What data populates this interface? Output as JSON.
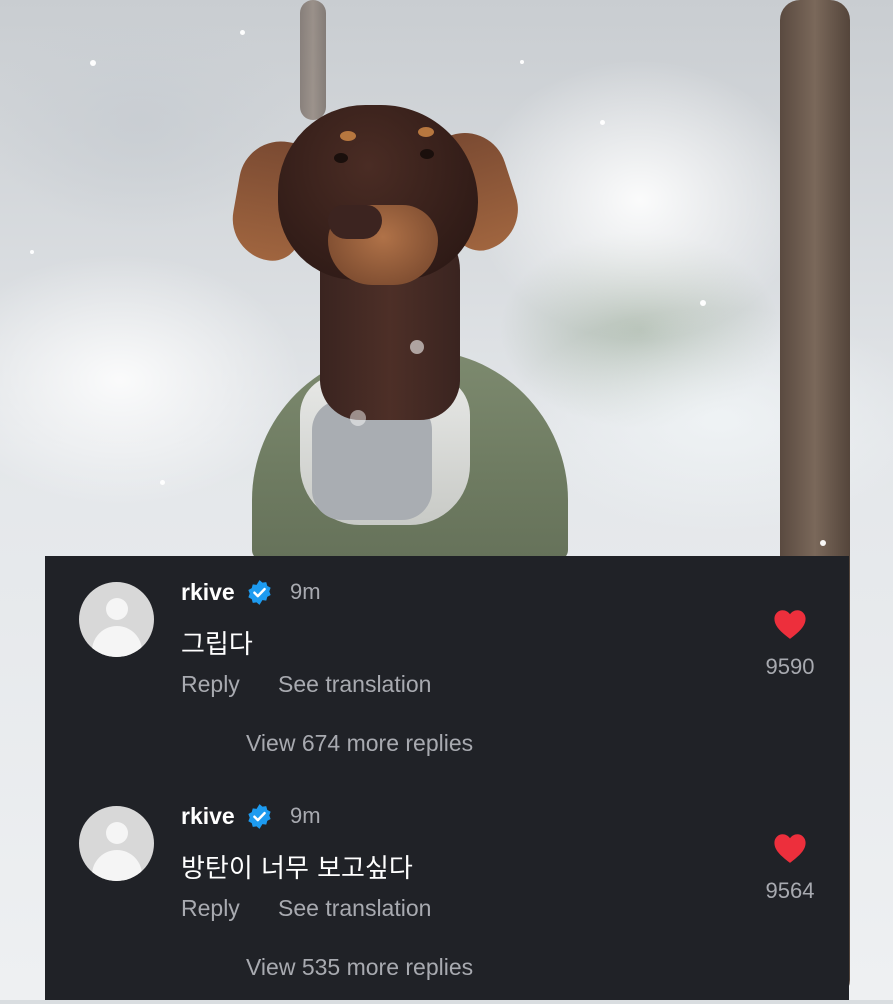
{
  "colors": {
    "panel_bg": "#202227",
    "text_primary": "#ffffff",
    "text_secondary": "#a8aab0",
    "verified": "#1d9bf0",
    "heart": "#ed2f3c",
    "avatar_bg": "#d8d8d8"
  },
  "photo": {
    "icon": "doberman-in-snow-photo"
  },
  "comments": [
    {
      "username": "rkive",
      "verified_icon": "verified-badge-icon",
      "time": "9m",
      "text": "그립다",
      "reply_label": "Reply",
      "translate_label": "See translation",
      "more_replies": "View 674 more replies",
      "likes": "9590",
      "like_icon": "heart-icon"
    },
    {
      "username": "rkive",
      "verified_icon": "verified-badge-icon",
      "time": "9m",
      "text": "방탄이 너무 보고싶다",
      "reply_label": "Reply",
      "translate_label": "See translation",
      "more_replies": "View 535 more replies",
      "likes": "9564",
      "like_icon": "heart-icon"
    }
  ]
}
